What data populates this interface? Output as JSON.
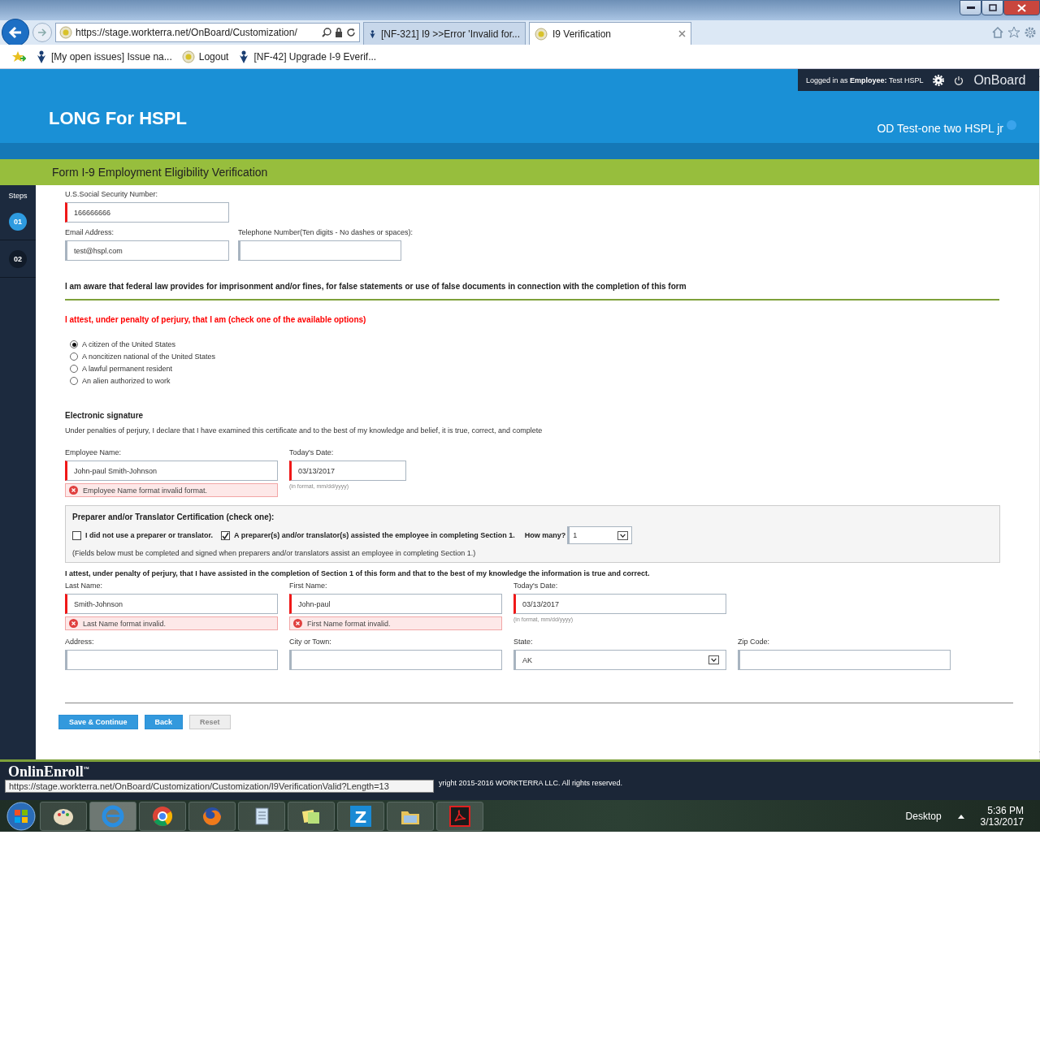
{
  "browser": {
    "address": "https://stage.workterra.net/OnBoard/Customization/",
    "tabs": [
      {
        "label": "[NF-321] I9 >>Error 'Invalid for...",
        "selected": false,
        "kind": "jira"
      },
      {
        "label": "I9 Verification",
        "selected": true,
        "kind": "site"
      }
    ],
    "favorites": [
      {
        "label": "[My open issues] Issue na...",
        "kind": "jira"
      },
      {
        "label": "Logout",
        "kind": "site"
      },
      {
        "label": "[NF-42] Upgrade I-9 Everif...",
        "kind": "jira"
      }
    ]
  },
  "header": {
    "login": "Logged in as **Employee:**  Test HSPL",
    "brand": "OnBoard",
    "title": "LONG For HSPL",
    "user": "OD Test-one two HSPL jr"
  },
  "section_title": "Form I-9 Employment Eligibility Verification",
  "steps": {
    "label": "Steps",
    "items": [
      {
        "label": "01",
        "selected": true
      },
      {
        "label": "02",
        "selected": false
      }
    ]
  },
  "contact": [
    {
      "label": "U.S.Social Security Number:",
      "value": "166666666",
      "invalid": true,
      "kind": "text"
    },
    {
      "label": "Email Address:",
      "value": "test@hspl.com",
      "invalid": false,
      "kind": "text"
    },
    {
      "label": "Telephone Number(Ten digits - No dashes or spaces):",
      "invalid": false,
      "kind": "text"
    }
  ],
  "warning": "I am aware that federal law provides for imprisonment and/or fines, for false statements or use of false documents in connection with the completion of this form",
  "attest": "I attest, under penalty of perjury, that I am (check one of the available options)",
  "status_options": [
    {
      "label": "A citizen of the United States",
      "selected": true
    },
    {
      "label": "A noncitizen national of the United States",
      "selected": false
    },
    {
      "label": "A lawful permanent resident",
      "selected": false
    },
    {
      "label": "An alien authorized to work",
      "selected": false
    }
  ],
  "signature": {
    "title": "Electronic signature",
    "text": "Under penalties of perjury, I declare that I have examined this certificate and to the best of my knowledge and belief, it is true, correct, and complete",
    "fields": [
      {
        "label": "Employee Name:",
        "value": "John-paul Smith-Johnson",
        "invalid": true,
        "error": "Employee Name format invalid format.",
        "kind": "text"
      },
      {
        "label": "Today's Date:",
        "value": "03/13/2017",
        "invalid": true,
        "hint": "(in format, mm/dd/yyyy)",
        "kind": "text"
      }
    ]
  },
  "preparer": {
    "title": "Preparer and/or Translator Certification (check one):",
    "options": [
      {
        "label": "I did not use a preparer or translator.",
        "checked": false
      },
      {
        "label": "A preparer(s) and/or translator(s) assisted the employee in completing Section 1.",
        "checked": true
      }
    ],
    "how_many_label": "How many?",
    "how_many": "1",
    "note": "(Fields below must be completed and signed when preparers and/or translators assist an employee in completing Section 1.)"
  },
  "preparer_attest": "I attest, under penalty of perjury, that I have assisted in the completion of Section 1 of this form and that to the best of my knowledge the information is true and correct.",
  "preparer_rows": [
    [
      {
        "label": "Last Name:",
        "value": "Smith-Johnson",
        "invalid": true,
        "error": "Last Name format invalid.",
        "kind": "text"
      },
      {
        "label": "First Name:",
        "value": "John-paul",
        "invalid": true,
        "error": "First Name format invalid.",
        "kind": "text"
      },
      {
        "label": "Today's Date:",
        "value": "03/13/2017",
        "invalid": true,
        "hint": "(in format, mm/dd/yyyy)",
        "kind": "text"
      }
    ],
    [
      {
        "label": "Address:",
        "invalid": false,
        "kind": "text"
      },
      {
        "label": "City or Town:",
        "invalid": false,
        "kind": "text"
      },
      {
        "label": "State:",
        "value": "AK",
        "invalid": false,
        "kind": "select"
      },
      {
        "label": "Zip Code:",
        "invalid": false,
        "kind": "text"
      }
    ]
  ],
  "buttons": [
    {
      "label": "Save & Continue",
      "kind": "primary"
    },
    {
      "label": "Back",
      "kind": "primary"
    },
    {
      "label": "Reset",
      "kind": "plain"
    }
  ],
  "footer": {
    "logo": "OnlinEnroll",
    "logo_mark": "™",
    "copyright": "yright 2015-2016 WORKTERRA LLC. All rights reserved.",
    "status_url": "https://stage.workterra.net/OnBoard/Customization/Customization/I9VerificationValid?Length=13"
  },
  "taskbar": {
    "desktop": "Desktop",
    "time": "5:36 PM",
    "date": "3/13/2017",
    "apps": [
      {
        "kind": "paint",
        "selected": false
      },
      {
        "kind": "ie",
        "selected": true
      },
      {
        "kind": "chrome",
        "selected": false
      },
      {
        "kind": "firefox",
        "selected": false
      },
      {
        "kind": "notepad",
        "selected": false
      },
      {
        "kind": "notes",
        "selected": false
      },
      {
        "kind": "z",
        "selected": false,
        "label": "Z"
      },
      {
        "kind": "folder",
        "selected": false
      },
      {
        "kind": "pdf",
        "selected": false
      }
    ]
  }
}
